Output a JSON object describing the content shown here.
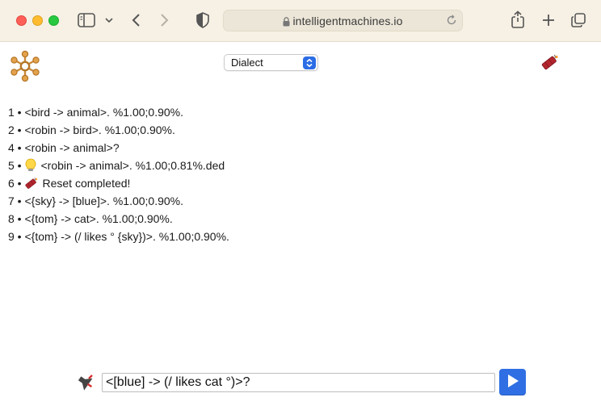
{
  "browser": {
    "url": "intelligentmachines.io"
  },
  "header": {
    "dialect": {
      "selected": "Dialect"
    }
  },
  "log": [
    {
      "n": "1",
      "text": "<bird -> animal>. %1.00;0.90%.",
      "icon": ""
    },
    {
      "n": "2",
      "text": "<robin -> bird>. %1.00;0.90%.",
      "icon": ""
    },
    {
      "n": "4",
      "text": "<robin -> animal>?",
      "icon": ""
    },
    {
      "n": "5",
      "text": "<robin -> animal>. %1.00;0.81%.ded",
      "icon": "lightbulb-icon"
    },
    {
      "n": "6",
      "text": "Reset completed!",
      "icon": "dynamite-icon"
    },
    {
      "n": "7",
      "text": "<{sky} -> [blue]>. %1.00;0.90%.",
      "icon": ""
    },
    {
      "n": "8",
      "text": "<{tom} -> cat>. %1.00;0.90%.",
      "icon": ""
    },
    {
      "n": "9",
      "text": "<{tom} -> (/ likes ° {sky})>. %1.00;0.90%.",
      "icon": ""
    }
  ],
  "footer": {
    "query_value": "<[blue] -> (/ likes cat °)>?"
  },
  "colors": {
    "accent": "#2f6fe3",
    "logo": "#c98a3a",
    "dynamite": "#b3262e"
  }
}
